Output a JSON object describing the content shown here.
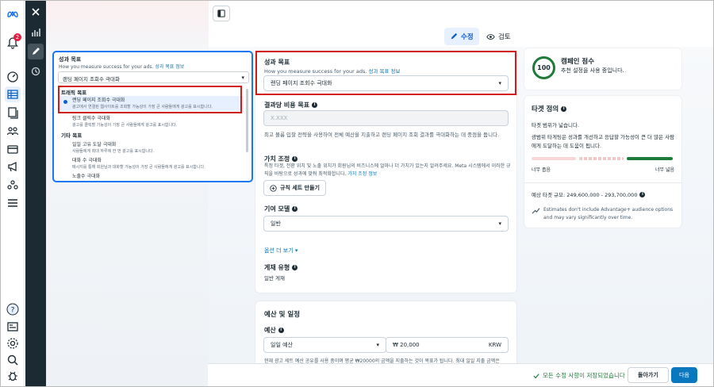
{
  "nav": {
    "notifications_count": "2"
  },
  "tabs": {
    "edit": "수정",
    "review": "검토"
  },
  "popover": {
    "title": "성과 목표",
    "subtitle": "How you measure success for your ads.",
    "subtitle_link": "성과 목표 정보",
    "selected": "랜딩 페이지 조회수 극대화",
    "groups": [
      {
        "label": "트래픽 목표",
        "options": [
          {
            "title": "랜딩 페이지 조회수 극대화",
            "desc": "광고에서 연결된 웹사이트를 조회할 가능성이 가장 큰 사람들에게 광고를 표시합니다.",
            "selected": true
          },
          {
            "title": "링크 클릭수 극대화",
            "desc": "광고를 클릭할 가능성이 가장 큰 사람들에게 광고를 표시합니다.",
            "selected": false
          }
        ]
      },
      {
        "label": "기타 목표",
        "options": [
          {
            "title": "일일 고유 도달 극대화",
            "desc": "사람들에게 최대 하루에 한 번 광고를 표시합니다.",
            "selected": false
          },
          {
            "title": "대화 수 극대화",
            "desc": "메시지를 통해 회원님과 대화할 가능성이 가장 큰 사람들에게 광고를 표시합니다.",
            "selected": false
          },
          {
            "title": "노출수 극대화",
            "desc": "",
            "selected": false
          }
        ]
      }
    ]
  },
  "main": {
    "perf_goal": {
      "label": "성과 목표",
      "subtitle": "How you measure success for your ads.",
      "subtitle_link": "성과 목표 정보",
      "value": "랜딩 페이지 조회수 극대화"
    },
    "cost_goal": {
      "label": "결과당 비용 목표",
      "placeholder": "X.XXX",
      "help": "최고 볼륨 입찰 전략을 사용하여 전체 예산을 지출하고 랜딩 페이지 조회 결과를 극대화하는 데 중점을 둡니다."
    },
    "value_rules": {
      "label": "가치 조정",
      "help": "특정 타겟, 전환 위치 및 노출 위치가 회원님의 비즈니스에 얼마나 더 가치가 있는지 알려주세요. Meta 시스템에서 이러한 규칙을 바탕으로 성과에 맞춰 최적화합니다.",
      "help_link": "가치 조정 정보",
      "button": "규칙 세트 만들기"
    },
    "attribution": {
      "label": "기여 모델",
      "value": "일반"
    },
    "more_options": "옵션 더 보기",
    "placement_type": {
      "label": "게재 유형",
      "value": "일반 게재"
    },
    "budget": {
      "section_title": "예산 및 일정",
      "label": "예산",
      "type": "일일 예산",
      "amount": "₩ 20,000",
      "currency": "KRW",
      "help": "현재 광고 세트 예산 공유를 사용 중이며 평균 ₩20000의 금액을 지출하는 것이 목표가 됩니다. 최대 일일 지출 금액은"
    }
  },
  "right": {
    "score": {
      "title": "캠페인 점수",
      "value": "100",
      "subtitle": "추천 설정을 사용 중입니다."
    },
    "audience": {
      "title": "타겟 정의",
      "status": "타겟 범위가 넓습니다.",
      "description": "광범위 타게팅은 성과를 개선하고 응답할 가능성이 큰 더 많은 사람에게 도달하는 데 도움이 됩니다.",
      "narrow": "너무 좁음",
      "broad": "너무 넓음",
      "estimate": "예상 타겟 규모: 249,600,000 - 293,700,000",
      "note": "Estimates don't include Advantage+ audience options and may vary significantly over time."
    }
  },
  "footer": {
    "saved": "모든 수정 사항이 저장되었습니다",
    "back": "돌아가기",
    "next": "다음"
  },
  "colors": {
    "accent": "#0a5fd4",
    "highlight": "#d21a1a",
    "success": "#1e7b3a"
  }
}
